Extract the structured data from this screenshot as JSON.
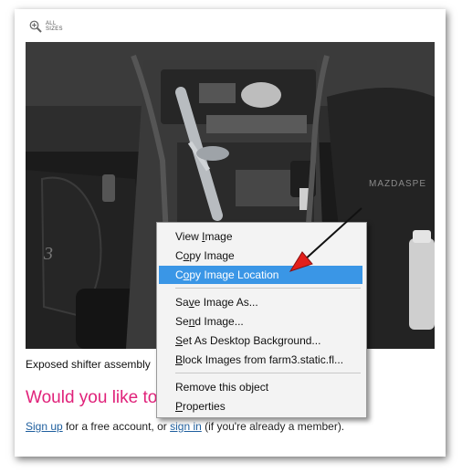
{
  "toolbar": {
    "zoom_icon": "magnifier-plus-icon",
    "all_sizes_label": "ALL SIZES"
  },
  "photo": {
    "brand_text": "MAZDASPE",
    "mat_text": "3"
  },
  "caption": "Exposed shifter assembly",
  "heading": "Would you like to",
  "signup": {
    "signup_link": "Sign up",
    "middle_text": " for a free account, or ",
    "signin_link": "sign in",
    "end_text": " (if you're already a member)."
  },
  "context_menu": {
    "items": [
      {
        "pre": "View ",
        "acc": "I",
        "post": "mage"
      },
      {
        "pre": "C",
        "acc": "o",
        "post": "py Image"
      },
      {
        "pre": "C",
        "acc": "o",
        "post": "py Image Location"
      },
      {
        "pre": "Sa",
        "acc": "v",
        "post": "e Image As..."
      },
      {
        "pre": "Se",
        "acc": "n",
        "post": "d Image..."
      },
      {
        "pre": "",
        "acc": "S",
        "post": "et As Desktop Background..."
      },
      {
        "pre": "",
        "acc": "B",
        "post": "lock Images from farm3.static.fl..."
      },
      {
        "pre": "Remove this object",
        "acc": "",
        "post": ""
      },
      {
        "pre": "",
        "acc": "P",
        "post": "roperties"
      }
    ],
    "highlight_color": "#3a96e6"
  },
  "colors": {
    "heading": "#e0227a",
    "link": "#1f5f9e",
    "arrow": "#e3201b"
  }
}
